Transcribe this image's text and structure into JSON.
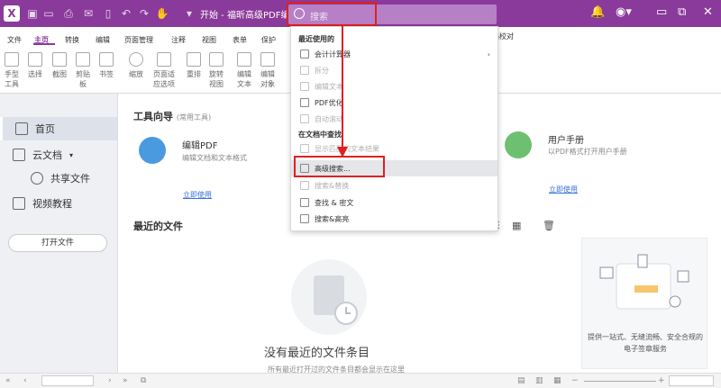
{
  "titlebar": {
    "title": "开始 - 福昕高级PDF编辑器",
    "search_placeholder": "搜索",
    "accent": "#8a3a9a"
  },
  "menu": [
    "文件",
    "主页",
    "转换",
    "编辑",
    "页面管理",
    "注释",
    "视图",
    "表单",
    "保护"
  ],
  "menu_extra": "档校对",
  "ribbon": [
    {
      "label": "手型\n工具",
      "icon": "hand-icon"
    },
    {
      "label": "选择",
      "icon": "select-icon"
    },
    {
      "label": "截图",
      "icon": "screenshot-icon"
    },
    {
      "label": "剪贴\n板",
      "icon": "clipboard-icon"
    },
    {
      "label": "书签",
      "icon": "bookmark-icon"
    },
    {
      "label": "缩放",
      "icon": "zoom-icon"
    },
    {
      "label": "页面适\n应选项",
      "icon": "fit-page-icon"
    },
    {
      "label": "重排",
      "icon": "reflow-icon"
    },
    {
      "label": "旋转\n视图",
      "icon": "rotate-icon"
    },
    {
      "label": "编辑\n文本",
      "icon": "edit-text-icon"
    },
    {
      "label": "编辑\n对象",
      "icon": "edit-object-icon"
    }
  ],
  "leftnav": {
    "home": "首页",
    "cloud": "云文档",
    "shared": "共享文件",
    "video": "视频教程",
    "open_file": "打开文件"
  },
  "tools": {
    "title": "工具向导",
    "subtitle": "(常用工具)",
    "edit_pdf_name": "编辑PDF",
    "edit_pdf_desc": "编辑文档和文本格式",
    "edit_pdf_link": "立即使用",
    "manual_name": "用户手册",
    "manual_desc": "以PDF格式打开用户手册",
    "manual_link": "立即使用"
  },
  "recent": {
    "title": "最近的文件",
    "empty_title": "没有最近的文件条目",
    "empty_sub": "所有最近打开过的文件条目都会显示在这里"
  },
  "promo": {
    "text": "提供一站式、无缝流畅、安全合规的电子签章服务"
  },
  "dropdown": {
    "recent_header": "最近使用的",
    "recent_items": [
      {
        "label": "会计计算器",
        "disabled": false
      },
      {
        "label": "拆分",
        "disabled": true
      },
      {
        "label": "编辑文本",
        "disabled": true
      },
      {
        "label": "PDF优化",
        "disabled": false
      },
      {
        "label": "自动滚动",
        "disabled": true
      }
    ],
    "doc_header": "在文档中查找",
    "doc_items": [
      {
        "label": "显示匹配的文本结果",
        "disabled": true
      },
      {
        "label": "高级搜索...",
        "disabled": false
      },
      {
        "label": "搜索&替换",
        "disabled": true
      },
      {
        "label": "查找 & 密文",
        "disabled": false
      },
      {
        "label": "搜索&高亮",
        "disabled": false
      }
    ]
  },
  "statusbar": {
    "zoom_label": ""
  }
}
